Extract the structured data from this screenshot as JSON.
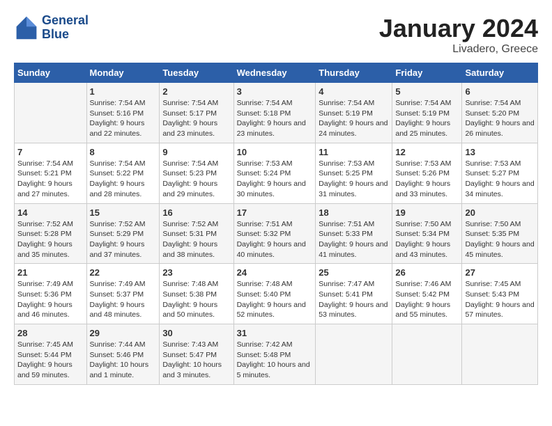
{
  "header": {
    "logo_text_1": "General",
    "logo_text_2": "Blue",
    "title": "January 2024",
    "subtitle": "Livadero, Greece"
  },
  "days_of_week": [
    "Sunday",
    "Monday",
    "Tuesday",
    "Wednesday",
    "Thursday",
    "Friday",
    "Saturday"
  ],
  "weeks": [
    [
      {
        "day": "",
        "sunrise": "",
        "sunset": "",
        "daylight": ""
      },
      {
        "day": "1",
        "sunrise": "Sunrise: 7:54 AM",
        "sunset": "Sunset: 5:16 PM",
        "daylight": "Daylight: 9 hours and 22 minutes."
      },
      {
        "day": "2",
        "sunrise": "Sunrise: 7:54 AM",
        "sunset": "Sunset: 5:17 PM",
        "daylight": "Daylight: 9 hours and 23 minutes."
      },
      {
        "day": "3",
        "sunrise": "Sunrise: 7:54 AM",
        "sunset": "Sunset: 5:18 PM",
        "daylight": "Daylight: 9 hours and 23 minutes."
      },
      {
        "day": "4",
        "sunrise": "Sunrise: 7:54 AM",
        "sunset": "Sunset: 5:19 PM",
        "daylight": "Daylight: 9 hours and 24 minutes."
      },
      {
        "day": "5",
        "sunrise": "Sunrise: 7:54 AM",
        "sunset": "Sunset: 5:19 PM",
        "daylight": "Daylight: 9 hours and 25 minutes."
      },
      {
        "day": "6",
        "sunrise": "Sunrise: 7:54 AM",
        "sunset": "Sunset: 5:20 PM",
        "daylight": "Daylight: 9 hours and 26 minutes."
      }
    ],
    [
      {
        "day": "7",
        "sunrise": "Sunrise: 7:54 AM",
        "sunset": "Sunset: 5:21 PM",
        "daylight": "Daylight: 9 hours and 27 minutes."
      },
      {
        "day": "8",
        "sunrise": "Sunrise: 7:54 AM",
        "sunset": "Sunset: 5:22 PM",
        "daylight": "Daylight: 9 hours and 28 minutes."
      },
      {
        "day": "9",
        "sunrise": "Sunrise: 7:54 AM",
        "sunset": "Sunset: 5:23 PM",
        "daylight": "Daylight: 9 hours and 29 minutes."
      },
      {
        "day": "10",
        "sunrise": "Sunrise: 7:53 AM",
        "sunset": "Sunset: 5:24 PM",
        "daylight": "Daylight: 9 hours and 30 minutes."
      },
      {
        "day": "11",
        "sunrise": "Sunrise: 7:53 AM",
        "sunset": "Sunset: 5:25 PM",
        "daylight": "Daylight: 9 hours and 31 minutes."
      },
      {
        "day": "12",
        "sunrise": "Sunrise: 7:53 AM",
        "sunset": "Sunset: 5:26 PM",
        "daylight": "Daylight: 9 hours and 33 minutes."
      },
      {
        "day": "13",
        "sunrise": "Sunrise: 7:53 AM",
        "sunset": "Sunset: 5:27 PM",
        "daylight": "Daylight: 9 hours and 34 minutes."
      }
    ],
    [
      {
        "day": "14",
        "sunrise": "Sunrise: 7:52 AM",
        "sunset": "Sunset: 5:28 PM",
        "daylight": "Daylight: 9 hours and 35 minutes."
      },
      {
        "day": "15",
        "sunrise": "Sunrise: 7:52 AM",
        "sunset": "Sunset: 5:29 PM",
        "daylight": "Daylight: 9 hours and 37 minutes."
      },
      {
        "day": "16",
        "sunrise": "Sunrise: 7:52 AM",
        "sunset": "Sunset: 5:31 PM",
        "daylight": "Daylight: 9 hours and 38 minutes."
      },
      {
        "day": "17",
        "sunrise": "Sunrise: 7:51 AM",
        "sunset": "Sunset: 5:32 PM",
        "daylight": "Daylight: 9 hours and 40 minutes."
      },
      {
        "day": "18",
        "sunrise": "Sunrise: 7:51 AM",
        "sunset": "Sunset: 5:33 PM",
        "daylight": "Daylight: 9 hours and 41 minutes."
      },
      {
        "day": "19",
        "sunrise": "Sunrise: 7:50 AM",
        "sunset": "Sunset: 5:34 PM",
        "daylight": "Daylight: 9 hours and 43 minutes."
      },
      {
        "day": "20",
        "sunrise": "Sunrise: 7:50 AM",
        "sunset": "Sunset: 5:35 PM",
        "daylight": "Daylight: 9 hours and 45 minutes."
      }
    ],
    [
      {
        "day": "21",
        "sunrise": "Sunrise: 7:49 AM",
        "sunset": "Sunset: 5:36 PM",
        "daylight": "Daylight: 9 hours and 46 minutes."
      },
      {
        "day": "22",
        "sunrise": "Sunrise: 7:49 AM",
        "sunset": "Sunset: 5:37 PM",
        "daylight": "Daylight: 9 hours and 48 minutes."
      },
      {
        "day": "23",
        "sunrise": "Sunrise: 7:48 AM",
        "sunset": "Sunset: 5:38 PM",
        "daylight": "Daylight: 9 hours and 50 minutes."
      },
      {
        "day": "24",
        "sunrise": "Sunrise: 7:48 AM",
        "sunset": "Sunset: 5:40 PM",
        "daylight": "Daylight: 9 hours and 52 minutes."
      },
      {
        "day": "25",
        "sunrise": "Sunrise: 7:47 AM",
        "sunset": "Sunset: 5:41 PM",
        "daylight": "Daylight: 9 hours and 53 minutes."
      },
      {
        "day": "26",
        "sunrise": "Sunrise: 7:46 AM",
        "sunset": "Sunset: 5:42 PM",
        "daylight": "Daylight: 9 hours and 55 minutes."
      },
      {
        "day": "27",
        "sunrise": "Sunrise: 7:45 AM",
        "sunset": "Sunset: 5:43 PM",
        "daylight": "Daylight: 9 hours and 57 minutes."
      }
    ],
    [
      {
        "day": "28",
        "sunrise": "Sunrise: 7:45 AM",
        "sunset": "Sunset: 5:44 PM",
        "daylight": "Daylight: 9 hours and 59 minutes."
      },
      {
        "day": "29",
        "sunrise": "Sunrise: 7:44 AM",
        "sunset": "Sunset: 5:46 PM",
        "daylight": "Daylight: 10 hours and 1 minute."
      },
      {
        "day": "30",
        "sunrise": "Sunrise: 7:43 AM",
        "sunset": "Sunset: 5:47 PM",
        "daylight": "Daylight: 10 hours and 3 minutes."
      },
      {
        "day": "31",
        "sunrise": "Sunrise: 7:42 AM",
        "sunset": "Sunset: 5:48 PM",
        "daylight": "Daylight: 10 hours and 5 minutes."
      },
      {
        "day": "",
        "sunrise": "",
        "sunset": "",
        "daylight": ""
      },
      {
        "day": "",
        "sunrise": "",
        "sunset": "",
        "daylight": ""
      },
      {
        "day": "",
        "sunrise": "",
        "sunset": "",
        "daylight": ""
      }
    ]
  ]
}
